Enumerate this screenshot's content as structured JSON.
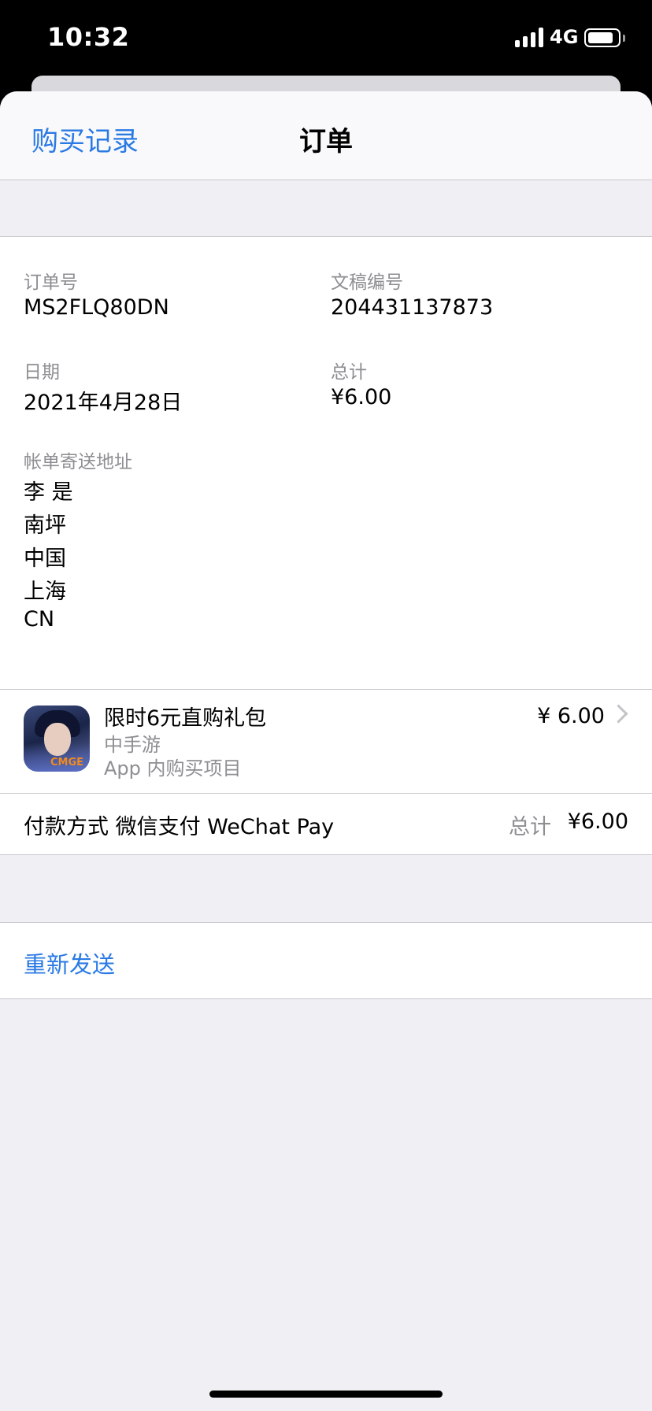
{
  "status_bar": {
    "time": "10:32",
    "network": "4G",
    "battery_level": 0.85
  },
  "nav": {
    "back_label": "购买记录",
    "title": "订单"
  },
  "order": {
    "order_number_label": "订单号",
    "order_number": "MS2FLQ80DN",
    "document_number_label": "文稿编号",
    "document_number": "204431137873",
    "date_label": "日期",
    "date": "2021年4月28日",
    "total_label": "总计",
    "total": "¥6.00",
    "billing_address_label": "帐单寄送地址",
    "billing_address": [
      "李 是",
      "南坪",
      "中国",
      "上海",
      "CN"
    ]
  },
  "item": {
    "title": "限时6元直购礼包",
    "developer": "中手游",
    "type": "App 内购买项目",
    "price": "¥ 6.00",
    "icon_logo_text": "CMGE"
  },
  "payment": {
    "label": "付款方式 微信支付 WeChat Pay",
    "total_label": "总计",
    "total_value": "¥6.00"
  },
  "actions": {
    "resend_label": "重新发送"
  },
  "colors": {
    "accent": "#2a7ae4",
    "secondary_text": "#8e8e93",
    "background": "#efeff4"
  }
}
